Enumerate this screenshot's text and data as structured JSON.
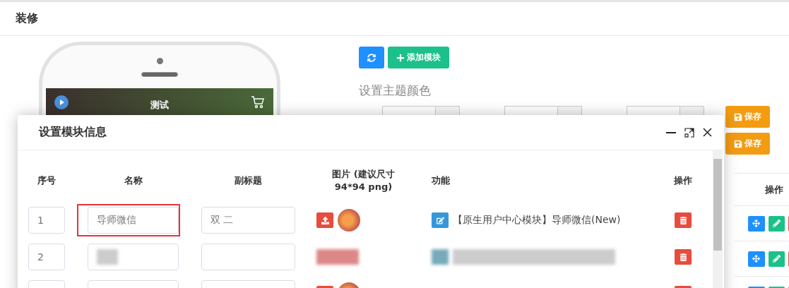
{
  "page": {
    "title": "装修"
  },
  "phone_preview": {
    "title": "测试"
  },
  "toolbar": {
    "add_button": "添加模块"
  },
  "theme": {
    "heading": "设置主题颜色",
    "color_fields": [
      {
        "kind": "color"
      },
      {
        "kind": "color"
      },
      {
        "kind": "color"
      }
    ],
    "save_buttons": [
      "保存",
      "保存"
    ]
  },
  "module_table": {
    "columns": [
      "操作"
    ],
    "rows": [
      {
        "actions": [
          {
            "kind": "move"
          },
          {
            "kind": "edit"
          },
          {
            "kind": "delete"
          }
        ]
      },
      {
        "actions": [
          {
            "kind": "move"
          },
          {
            "kind": "edit"
          },
          {
            "kind": "delete"
          }
        ]
      },
      {
        "actions": [
          {
            "kind": "move"
          },
          {
            "kind": "edit"
          },
          {
            "kind": "delete"
          }
        ]
      }
    ]
  },
  "dialog": {
    "title": "设置模块信息",
    "columns": [
      "序号",
      "名称",
      "副标题",
      "图片 (建议尺寸 94*94 png)",
      "功能",
      "操作"
    ],
    "rows": [
      {
        "index": "1",
        "name": "导师微信",
        "highlighted": true,
        "subtitle": "双 二",
        "function": "【原生用户中心模块】导师微信(New)",
        "blurred": false
      },
      {
        "index": "2",
        "highlighted": false,
        "blurred": true
      },
      {
        "highlighted": false,
        "blurred": false
      }
    ]
  }
}
